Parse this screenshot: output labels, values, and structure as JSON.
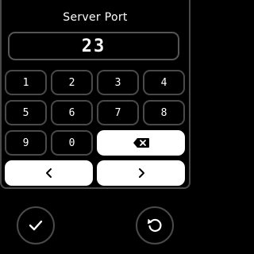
{
  "dialog": {
    "title": "Server Port",
    "value": "23"
  },
  "keypad": {
    "keys": [
      {
        "label": "1"
      },
      {
        "label": "2"
      },
      {
        "label": "3"
      },
      {
        "label": "4"
      },
      {
        "label": "5"
      },
      {
        "label": "6"
      },
      {
        "label": "7"
      },
      {
        "label": "8"
      },
      {
        "label": "9"
      },
      {
        "label": "0"
      }
    ],
    "backspace_icon": "backspace-icon",
    "cursor_left_icon": "chevron-left-icon",
    "cursor_right_icon": "chevron-right-icon"
  },
  "footer": {
    "confirm_icon": "checkmark-icon",
    "reset_icon": "reset-icon"
  },
  "colors": {
    "background": "#000000",
    "border": "#4a4a4a",
    "text": "#ffffff",
    "active_key": "#ffffff"
  }
}
